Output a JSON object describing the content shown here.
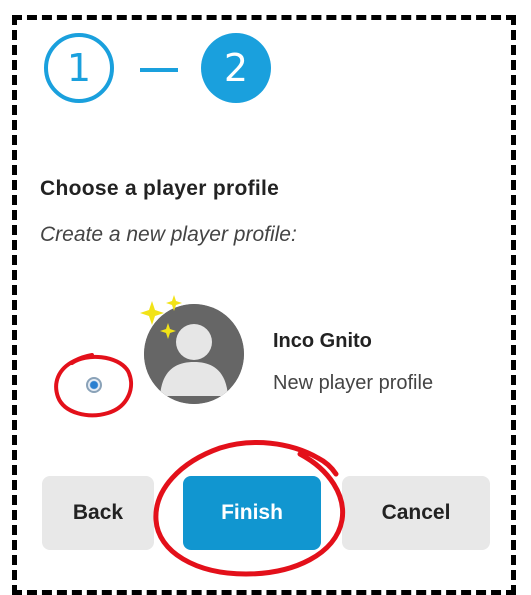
{
  "stepper": {
    "step1": "1",
    "step2": "2",
    "accent": "#1aa0dd"
  },
  "heading": "Choose a player profile",
  "subheading": "Create a new player profile:",
  "profile": {
    "name": "Inco Gnito",
    "description": "New player profile",
    "selected": true,
    "avatar_icon": "user-silhouette-icon",
    "badge_icon": "sparkle-icon"
  },
  "buttons": {
    "back": "Back",
    "finish": "Finish",
    "cancel": "Cancel",
    "primary_color": "#1196d0"
  },
  "annotations": {
    "color": "#e3101a"
  }
}
